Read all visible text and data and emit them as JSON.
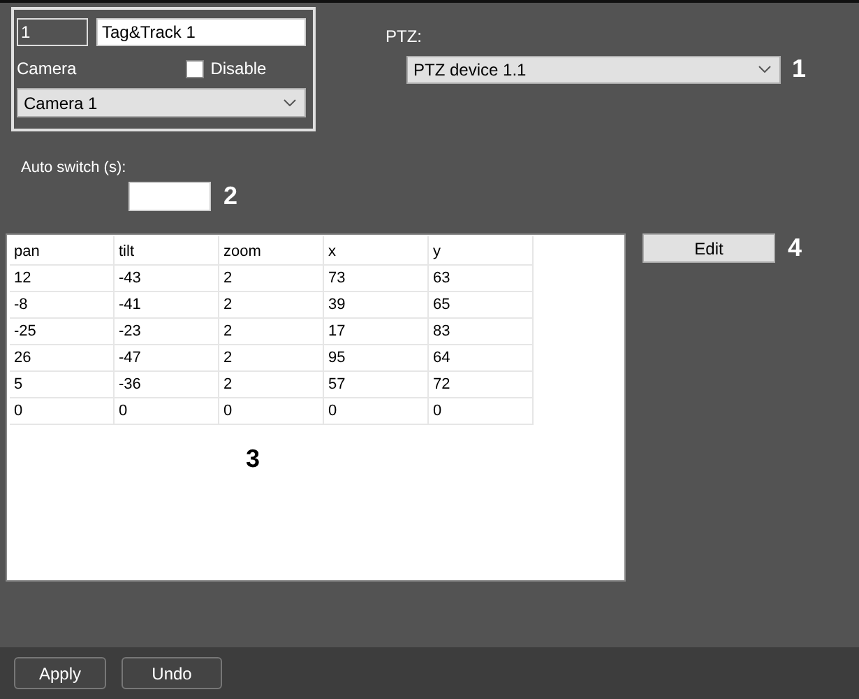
{
  "group": {
    "id_field": {
      "value": "1"
    },
    "name_field": {
      "value": "Tag&Track 1"
    },
    "camera_label": "Camera",
    "disable": {
      "label": "Disable",
      "checked": false
    },
    "camera_select": {
      "value": "Camera 1"
    }
  },
  "ptz": {
    "label": "PTZ:",
    "select": {
      "value": "PTZ device 1.1"
    }
  },
  "auto_switch": {
    "label": "Auto switch (s):"
  },
  "table": {
    "columns": [
      "pan",
      "tilt",
      "zoom",
      "x",
      "y"
    ],
    "rows": [
      [
        "12",
        "-43",
        "2",
        "73",
        "63"
      ],
      [
        "-8",
        "-41",
        "2",
        "39",
        "65"
      ],
      [
        "-25",
        "-23",
        "2",
        "17",
        "83"
      ],
      [
        "26",
        "-47",
        "2",
        "95",
        "64"
      ],
      [
        "5",
        "-36",
        "2",
        "57",
        "72"
      ],
      [
        "0",
        "0",
        "0",
        "0",
        "0"
      ]
    ]
  },
  "edit_button": "Edit",
  "callouts": [
    "1",
    "2",
    "3",
    "4"
  ],
  "footer_buttons": [
    "Apply",
    "Undo"
  ]
}
